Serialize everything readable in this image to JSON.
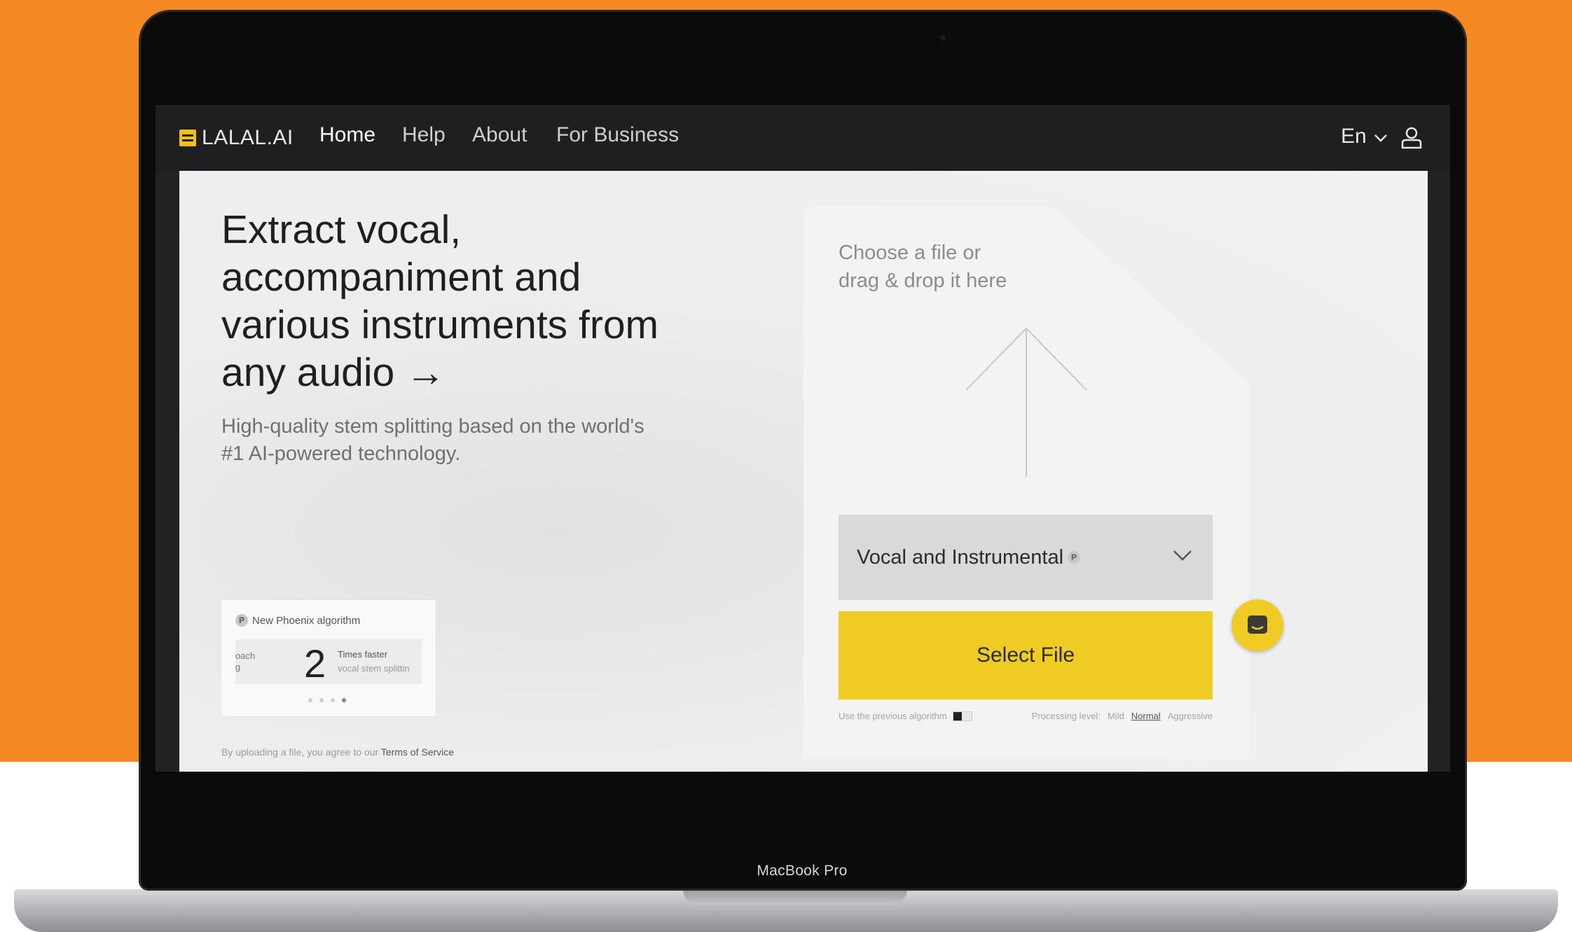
{
  "device": {
    "label": "MacBook Pro"
  },
  "nav": {
    "logo": "LALAL.AI",
    "items": [
      {
        "label": "Home"
      },
      {
        "label": "Help"
      },
      {
        "label": "About"
      },
      {
        "label": "For Business"
      }
    ],
    "active": "Home",
    "language": "En"
  },
  "hero": {
    "headline": "Extract vocal, accompaniment and various instruments from any audio →",
    "subline": "High-quality stem splitting based on the world's #1 AI-powered technology."
  },
  "promo": {
    "badge": "P",
    "heading": "New Phoenix algorithm",
    "left_fragment_1": "oach",
    "left_fragment_2": "g",
    "number": "2",
    "right_title": "Times faster",
    "right_sub": "vocal stem splittin"
  },
  "terms": {
    "text": "By uploading a file, you agree to our ",
    "link": "Terms of Service"
  },
  "upload": {
    "hint_line1": "Choose a file or",
    "hint_line2": "drag & drop it here",
    "stem_selected": "Vocal and Instrumental",
    "stem_badge": "P",
    "select_button": "Select File",
    "previous_algorithm_label": "Use the previous algorithm",
    "processing_label": "Processing level:",
    "levels": [
      "Mild",
      "Normal",
      "Aggressive"
    ],
    "selected_level": "Normal"
  },
  "colors": {
    "accent": "#efcb24",
    "background": "#f58a24",
    "nav": "#1f1f22"
  }
}
